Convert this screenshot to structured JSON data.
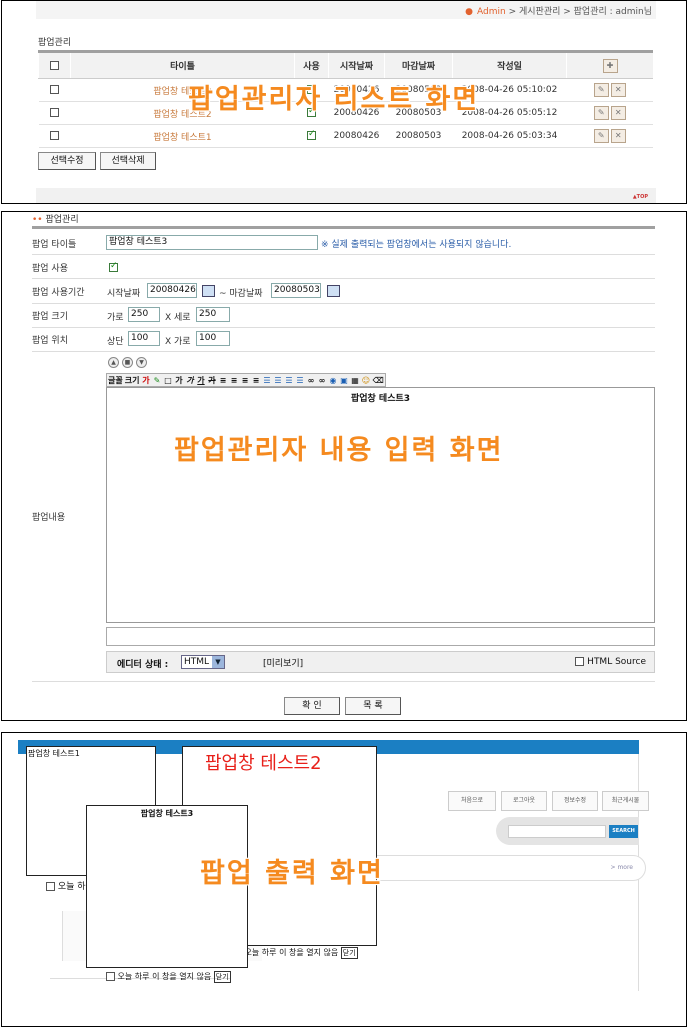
{
  "list_screen": {
    "breadcrumb": {
      "admin": "Admin",
      "rest": "> 게시판관리 > 팝업관리 : admin님"
    },
    "page_title": "팝업관리",
    "columns": [
      "타이틀",
      "사용",
      "시작날짜",
      "마감날짜",
      "작성일"
    ],
    "rows": [
      {
        "title": "팝업창 테스트3",
        "start": "20080426",
        "end": "20080503",
        "created": "2008-04-26 05:10:02"
      },
      {
        "title": "팝업창 테스트2",
        "start": "20080426",
        "end": "20080503",
        "created": "2008-04-26 05:05:12"
      },
      {
        "title": "팝업창 테스트1",
        "start": "20080426",
        "end": "20080503",
        "created": "2008-04-26 05:03:34"
      }
    ],
    "buttons": {
      "edit_selected": "선택수정",
      "delete_selected": "선택삭제"
    },
    "top_link": "▲TOP",
    "overlay": "팝업관리자 리스트 화면"
  },
  "form_screen": {
    "header": "팝업관리",
    "fields": {
      "title_label": "팝업 타이틀",
      "title_value": "팝업창 테스트3",
      "title_note": "※ 실제 출력되는 팝업창에서는 사용되지 않습니다.",
      "use_label": "팝업 사용",
      "period_label": "팝업 사용기간",
      "start_label": "시작날짜",
      "start_value": "20080426",
      "tilde": "~ 마감날짜",
      "end_value": "20080503",
      "size_label": "팝업 크기",
      "width_label": "가로",
      "width_value": "250",
      "height_label": "X 세로",
      "height_value": "250",
      "pos_label": "팝업 위치",
      "top_label": "상단",
      "top_value": "100",
      "left_label": "X 가로",
      "left_value": "100",
      "content_label": "팝업내용"
    },
    "toolbar": [
      "글꼴",
      "크기",
      "가",
      "✎",
      "□",
      "가",
      "가",
      "가",
      "가",
      "≡",
      "≡",
      "≡",
      "≡",
      "☰",
      "☰",
      "☰",
      "☰",
      "∞",
      "∞",
      "◉",
      "▣",
      "▦",
      "☺",
      "⌫"
    ],
    "editor_content": "팝업창 테스트3",
    "status_label": "에디터 상태 :",
    "status_mode": "HTML",
    "preview": "[미리보기]",
    "html_source": "HTML Source",
    "ok": "확 인",
    "list": "목 록",
    "overlay": "팝업관리자 내용 입력 화면"
  },
  "output_screen": {
    "popup1_title": "팝업창 테스트1",
    "popup2_title": "팝업창 테스트2",
    "popup3_title": "팝업창 테스트3",
    "dont_show": "오늘 하루 이 창을 열지 않음",
    "close": "닫기",
    "nav": [
      "처음으로",
      "로그아웃",
      "정보수정",
      "최근게시물"
    ],
    "search": "SEARCH",
    "partial_today": "오늘 하",
    "more": "> more",
    "overlay": "팝업 출력 화면"
  },
  "colors": {
    "accent": "#e2622f",
    "overlay": "#f58a1f",
    "link_title": "#c87a3c",
    "note": "#2a5da8",
    "site_blue": "#1b7fc3"
  }
}
